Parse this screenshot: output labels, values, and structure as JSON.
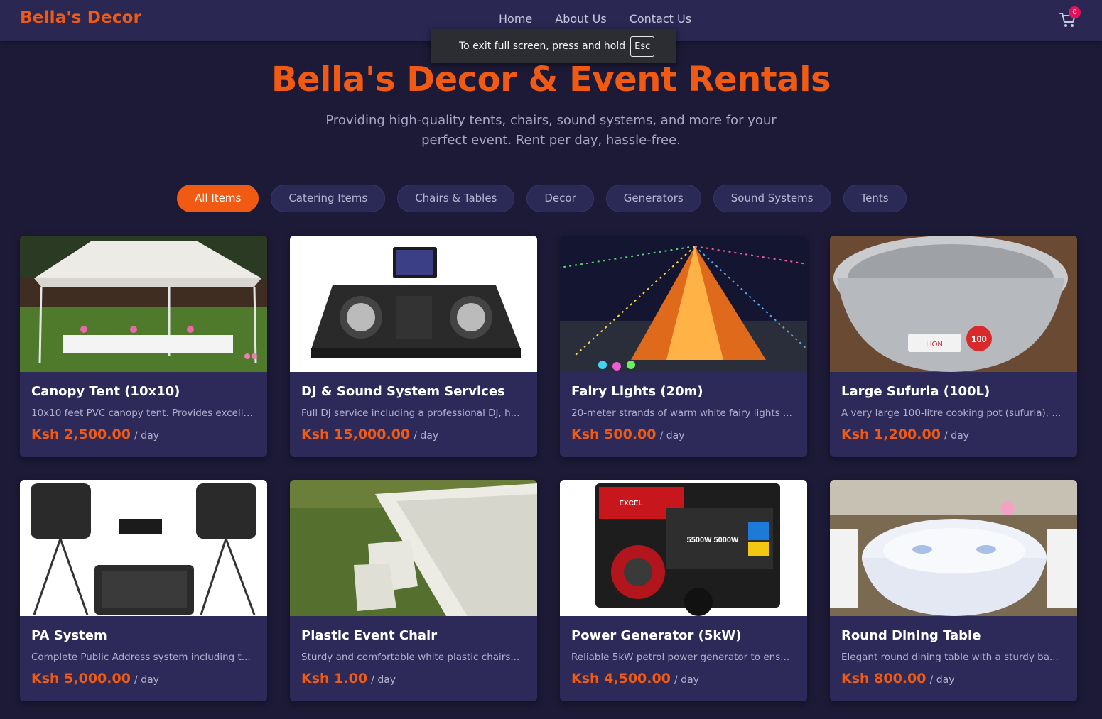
{
  "header": {
    "brand": "Bella's Decor",
    "nav": [
      "Home",
      "About Us",
      "Contact Us"
    ],
    "cart_count": "0",
    "cart_icon": "shopping-cart-icon"
  },
  "fullscreen_notice": {
    "text": "To exit full screen, press and hold",
    "key": "Esc"
  },
  "hero": {
    "title": "Bella's Decor & Event Rentals",
    "subtitle_line1": "Providing high-quality tents, chairs, sound systems, and more for your",
    "subtitle_line2": "perfect event. Rent per day, hassle-free."
  },
  "filters": {
    "items": [
      "All Items",
      "Catering Items",
      "Chairs & Tables",
      "Decor",
      "Generators",
      "Sound Systems",
      "Tents"
    ],
    "active": "All Items"
  },
  "colors": {
    "accent": "#f05a12",
    "background": "#1c1a36",
    "card": "#2d2a5a",
    "badge": "#e0135b"
  },
  "products": [
    {
      "title": "Canopy Tent (10x10)",
      "desc": "10x10 feet PVC canopy tent. Provides excelle...",
      "price": "Ksh 2,500.00",
      "unit": "/ day"
    },
    {
      "title": "DJ & Sound System Services",
      "desc": "Full DJ service including a professional DJ, h...",
      "price": "Ksh 15,000.00",
      "unit": "/ day"
    },
    {
      "title": "Fairy Lights (20m)",
      "desc": "20-meter strands of warm white fairy lights ...",
      "price": "Ksh 500.00",
      "unit": "/ day"
    },
    {
      "title": "Large Sufuria (100L)",
      "desc": "A very large 100-litre cooking pot (sufuria), ...",
      "price": "Ksh 1,200.00",
      "unit": "/ day"
    },
    {
      "title": "PA System",
      "desc": "Complete Public Address system including t...",
      "price": "Ksh 5,000.00",
      "unit": "/ day"
    },
    {
      "title": "Plastic Event Chair",
      "desc": "Sturdy and comfortable white plastic chairs...",
      "price": "Ksh 1.00",
      "unit": "/ day"
    },
    {
      "title": "Power Generator (5kW)",
      "desc": "Reliable 5kW petrol power generator to ens...",
      "price": "Ksh 4,500.00",
      "unit": "/ day"
    },
    {
      "title": "Round Dining Table",
      "desc": "Elegant round dining table with a sturdy ba...",
      "price": "Ksh 800.00",
      "unit": "/ day"
    }
  ],
  "image_labels": {
    "sufuria_badge": "100",
    "sufuria_brand": "LION",
    "generator_brand": "EXCEL",
    "generator_rating": "5500W 5000W"
  }
}
